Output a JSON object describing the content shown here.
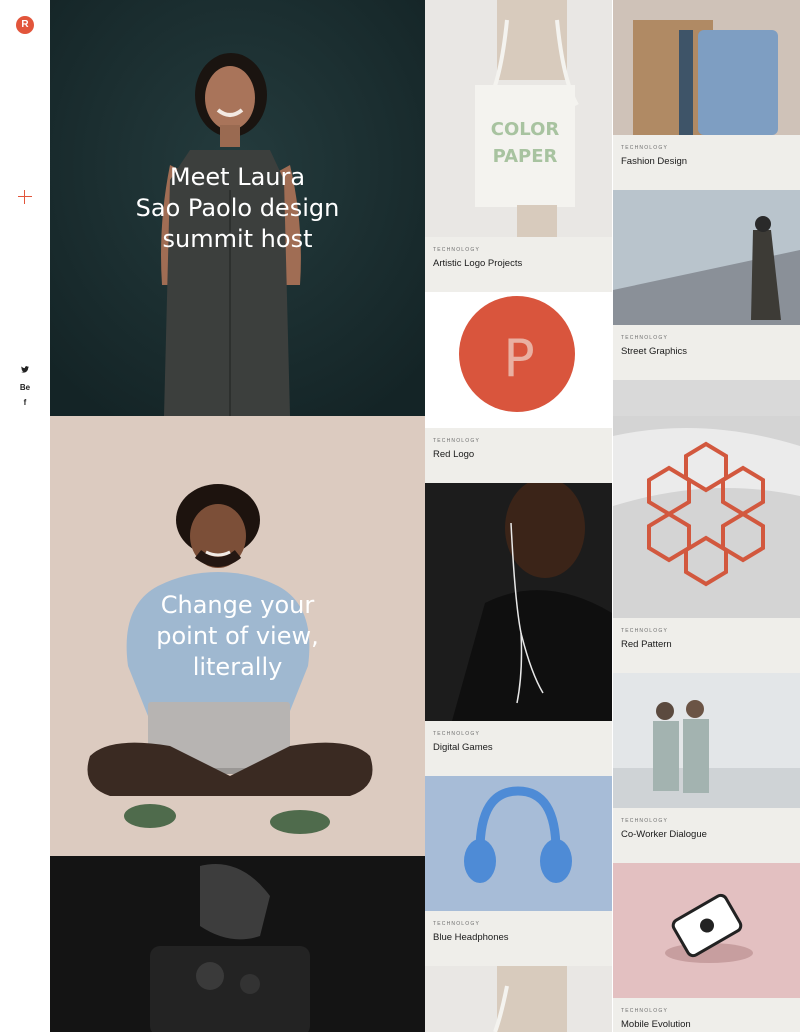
{
  "sidebar": {
    "logo_letter": "R",
    "social": {
      "twitter": "🐦",
      "behance": "Be",
      "facebook": "f"
    }
  },
  "heroes": [
    {
      "text": "Meet Laura Sao Paolo design summit host",
      "lines": [
        "Meet Laura",
        "Sao Paolo design",
        "summit host"
      ]
    },
    {
      "text": "Change your point of view, literally",
      "lines": [
        "Change your",
        "point of view,",
        "literally"
      ]
    },
    {
      "text": ""
    }
  ],
  "cards": [
    {
      "category": "TECHNOLOGY",
      "title": "Artistic Logo Projects"
    },
    {
      "category": "TECHNOLOGY",
      "title": "Red Logo"
    },
    {
      "category": "TECHNOLOGY",
      "title": "Digital Games"
    },
    {
      "category": "TECHNOLOGY",
      "title": "Blue Headphones"
    },
    {
      "category": "TECHNOLOGY",
      "title": "Fashion Design"
    },
    {
      "category": "TECHNOLOGY",
      "title": "Street Graphics"
    },
    {
      "category": "TECHNOLOGY",
      "title": "Red Pattern"
    },
    {
      "category": "TECHNOLOGY",
      "title": "Co-Worker Dialogue"
    },
    {
      "category": "TECHNOLOGY",
      "title": "Mobile Evolution"
    }
  ],
  "image_labels": {
    "tote_bag": "COLOR PAPER",
    "red_sticker": "P"
  },
  "colors": {
    "accent": "#e2553b",
    "caption_bg": "#efeeea"
  }
}
